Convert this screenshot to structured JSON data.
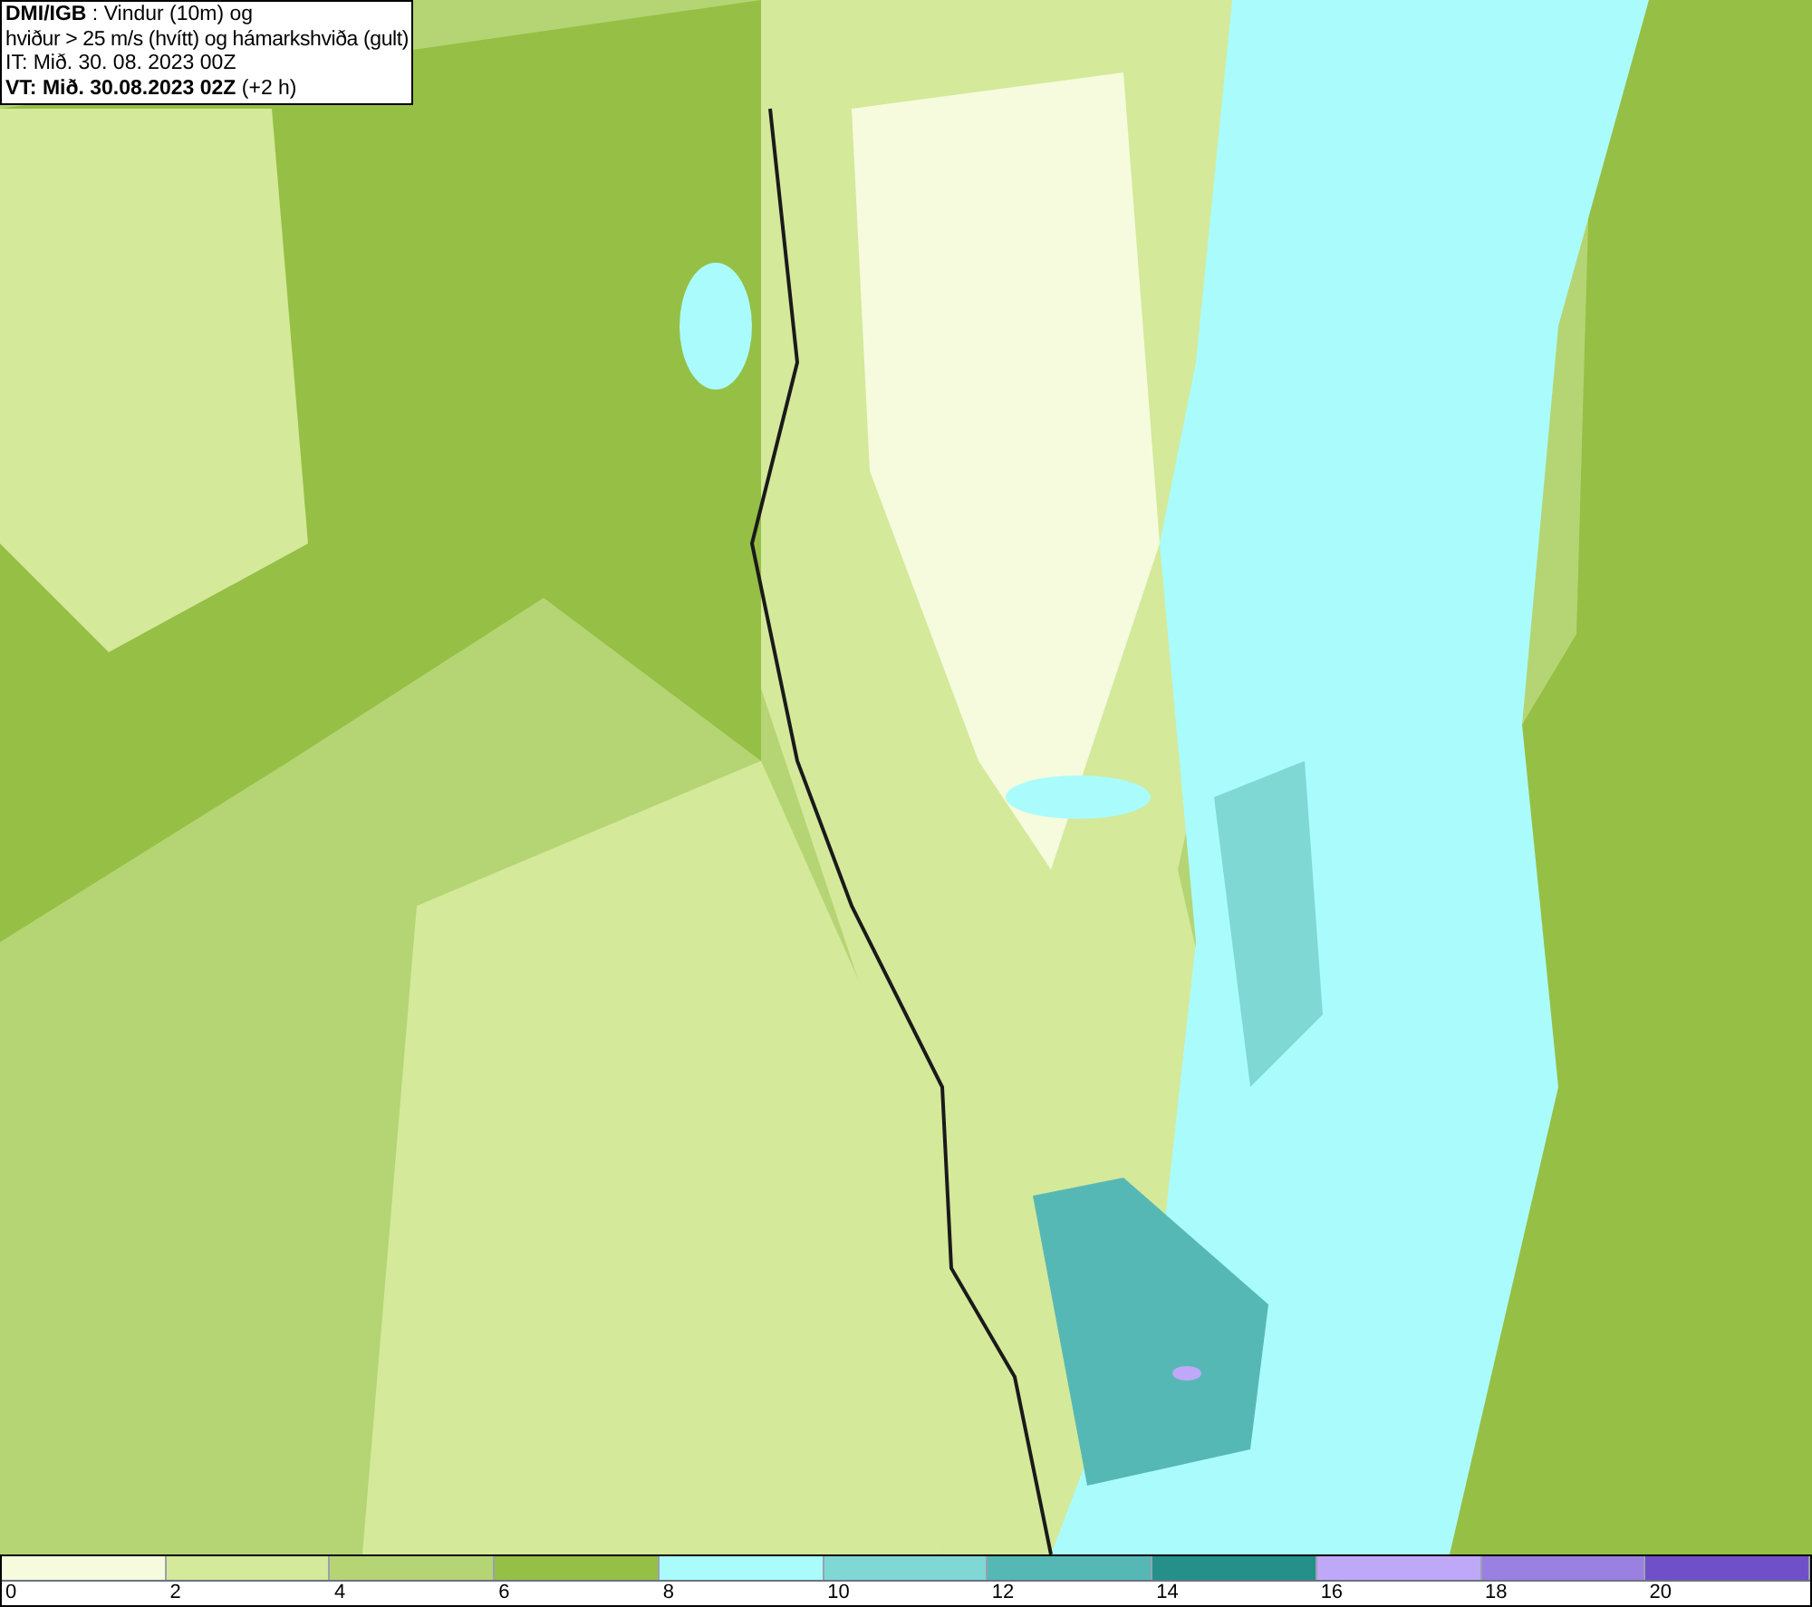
{
  "header": {
    "source": "DMI/IGB",
    "title_rest": " : Vindur (10m) og",
    "line_2": "hviður > 25 m/s (hvítt) og hámarkshviða (gult)",
    "issue_time": "IT: Mið. 30. 08. 2023 00Z",
    "valid_label": "VT: Mið. 30.08.2023 02Z",
    "valid_offset": " (+2 h)"
  },
  "legend": [
    {
      "label": "0",
      "color": "#f5fbdc"
    },
    {
      "label": "2",
      "color": "#d4e99a"
    },
    {
      "label": "4",
      "color": "#b5d574"
    },
    {
      "label": "6",
      "color": "#96bf45"
    },
    {
      "label": "8",
      "color": "#aafcfc"
    },
    {
      "label": "10",
      "color": "#7fd8d4"
    },
    {
      "label": "12",
      "color": "#56b8b4"
    },
    {
      "label": "14",
      "color": "#249089"
    },
    {
      "label": "16",
      "color": "#c0a8f8"
    },
    {
      "label": "18",
      "color": "#9a80e0"
    },
    {
      "label": "20",
      "color": "#7050c8"
    }
  ]
}
